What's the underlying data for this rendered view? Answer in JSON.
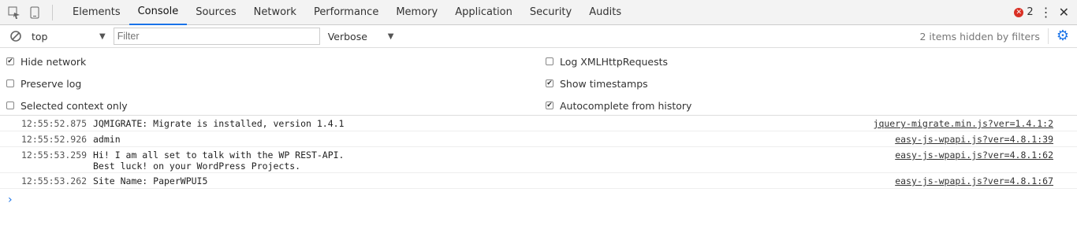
{
  "tabbar": {
    "tabs": [
      {
        "label": "Elements"
      },
      {
        "label": "Console"
      },
      {
        "label": "Sources"
      },
      {
        "label": "Network"
      },
      {
        "label": "Performance"
      },
      {
        "label": "Memory"
      },
      {
        "label": "Application"
      },
      {
        "label": "Security"
      },
      {
        "label": "Audits"
      }
    ],
    "error_count": "2"
  },
  "consolebar": {
    "context_value": "top",
    "filter_placeholder": "Filter",
    "level_value": "Verbose",
    "hidden_items": "2 items hidden by filters"
  },
  "settings": {
    "hide_network": "Hide network",
    "preserve_log": "Preserve log",
    "selected_context_only": "Selected context only",
    "log_xmlhttprequests": "Log XMLHttpRequests",
    "show_timestamps": "Show timestamps",
    "autocomplete_from_history": "Autocomplete from history"
  },
  "messages": [
    {
      "time": "12:55:52.875",
      "text": "JQMIGRATE: Migrate is installed, version 1.4.1",
      "source": "jquery-migrate.min.js?ver=1.4.1:2"
    },
    {
      "time": "12:55:52.926",
      "text": "admin",
      "source": "easy-js-wpapi.js?ver=4.8.1:39"
    },
    {
      "time": "12:55:53.259",
      "text": "Hi! I am all set to talk with the WP REST-API.\nBest luck! on your WordPress Projects.",
      "source": "easy-js-wpapi.js?ver=4.8.1:62"
    },
    {
      "time": "12:55:53.262",
      "text": "Site Name: PaperWPUI5",
      "source": "easy-js-wpapi.js?ver=4.8.1:67"
    }
  ],
  "icons": {
    "inspect": "inspect-element-icon",
    "device": "device-toolbar-icon",
    "clear": "clear-console-icon",
    "settings": "gear-icon",
    "more": "kebab-menu-icon",
    "close": "close-icon",
    "prompt": "console-prompt-icon"
  },
  "colors": {
    "accent": "#1a73e8",
    "error": "#d93025"
  }
}
